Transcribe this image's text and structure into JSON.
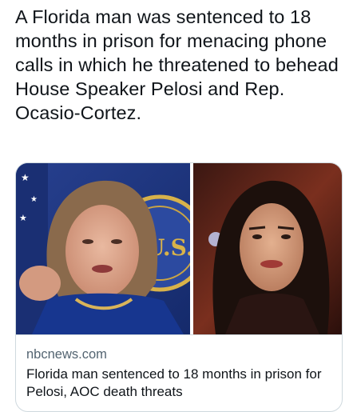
{
  "tweet": {
    "text": "A Florida man was sentenced to 18 months in prison for menacing phone calls in which he threatened to behead House Speaker Pelosi and Rep. Ocasio-Cortez."
  },
  "card": {
    "domain": "nbcnews.com",
    "title": "Florida man sentenced to 18 months in prison for Pelosi, AOC death threats",
    "seal_text": "U.S.",
    "colors": {
      "border": "#cfd9de",
      "domain_text": "#536471",
      "title_text": "#0f1419",
      "left_bg": "#1f3a8a",
      "right_bg": "#6b2a1c"
    }
  }
}
